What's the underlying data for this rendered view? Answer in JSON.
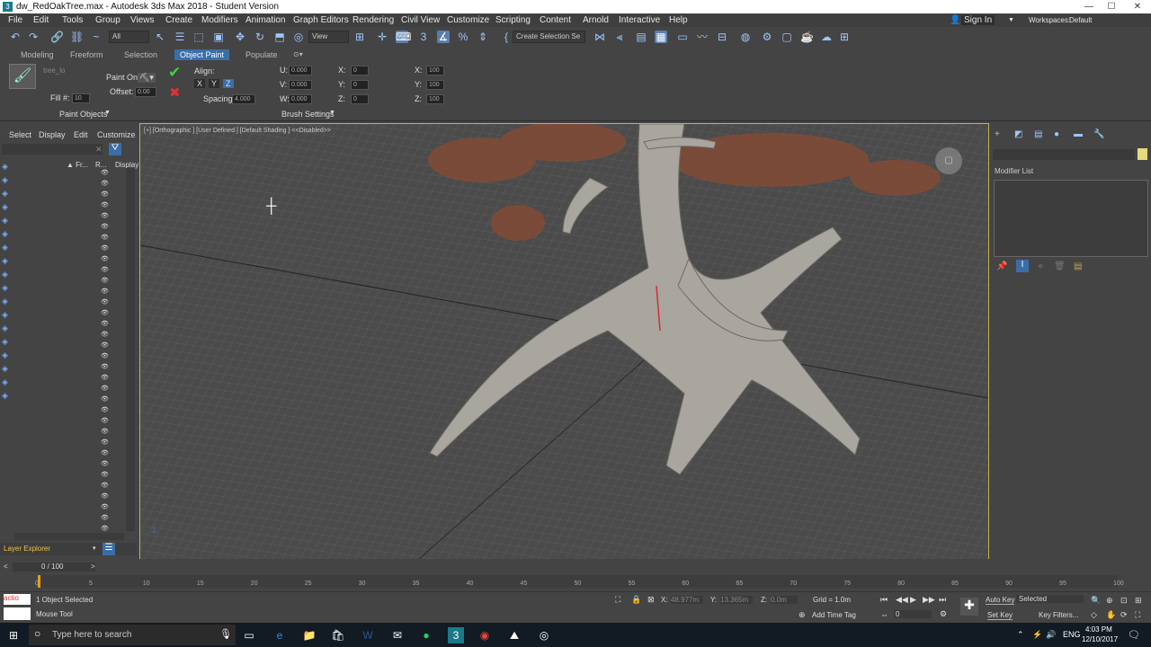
{
  "window": {
    "title": "dw_RedOakTree.max - Autodesk 3ds Max 2018 - Student Version",
    "controls": [
      "—",
      "☐",
      "✕"
    ]
  },
  "menu": {
    "items": [
      "File",
      "Edit",
      "Tools",
      "Group",
      "Views",
      "Create",
      "Modifiers",
      "Animation",
      "Graph Editors",
      "Rendering",
      "Civil View",
      "Customize",
      "Scripting",
      "Content",
      "Arnold",
      "Interactive",
      "Help"
    ],
    "sign_in": "Sign In",
    "workspaces_label": "Workspaces:",
    "workspace_value": "Default"
  },
  "toolbar": {
    "filter_value": "All",
    "view_value": "View",
    "selection_set": "Create Selection Se"
  },
  "ribbon": {
    "tabs": [
      "Modeling",
      "Freeform",
      "Selection",
      "Object Paint",
      "Populate"
    ],
    "active_tab": "Object Paint",
    "tree_name": "tree_lo",
    "paint_on_label": "Paint On:",
    "offset_label": "Offset:",
    "offset_value": "0.00",
    "fill_label": "Fill #:",
    "fill_value": "10",
    "align_label": "Align:",
    "axes": [
      "X",
      "Y",
      "Z"
    ],
    "spacing_label": "Spacing:",
    "spacing_value": "4.000",
    "u_label": "U:",
    "u_value": "0.000",
    "v_label": "V:",
    "v_value": "0.000",
    "w_label": "W:",
    "w_value": "0.000",
    "rx_label": "X:",
    "rx_value": "0",
    "ry_label": "Y:",
    "ry_value": "0",
    "rz_label": "Z:",
    "rz_value": "0",
    "sx_label": "X:",
    "sx_value": "100",
    "sy_label": "Y:",
    "sy_value": "100",
    "sz_label": "Z:",
    "sz_value": "100",
    "paint_objects_label": "Paint Objects",
    "brush_settings_label": "Brush Settings"
  },
  "scene_explorer": {
    "menu": [
      "Select",
      "Display",
      "Edit",
      "Customize"
    ],
    "col_frozen": "▲ Fr...",
    "col_render": "R...",
    "col_display": "Display",
    "layer_explorer_label": "Layer Explorer"
  },
  "viewport": {
    "label": "[+] [Orthographic ] [User Defined ] [Default Shading ]  <<Disabled>>"
  },
  "command_panel": {
    "modifier_list_label": "Modifier List"
  },
  "timeline": {
    "frame_counter": "0 / 100",
    "ticks": [
      "0",
      "5",
      "10",
      "15",
      "20",
      "25",
      "30",
      "35",
      "40",
      "45",
      "50",
      "55",
      "60",
      "65",
      "70",
      "75",
      "80",
      "85",
      "90",
      "95",
      "100"
    ]
  },
  "status": {
    "maxscript_label": "actio",
    "selected_text": "1 Object Selected",
    "prompt_text": "Mouse Tool",
    "x_label": "X:",
    "x_value": "48.977m",
    "y_label": "Y:",
    "y_value": "13.365m",
    "z_label": "Z:",
    "z_value": "0.0m",
    "grid_text": "Grid = 1.0m",
    "add_time_tag": "Add Time Tag",
    "frame_value": "0",
    "auto_key": "Auto Key",
    "set_key": "Set Key",
    "selected_dropdown": "Selected",
    "key_filters": "Key Filters..."
  },
  "taskbar": {
    "search_placeholder": "Type here to search",
    "lang": "ENG",
    "time": "4:03 PM",
    "date": "12/10/2017"
  },
  "colors": {
    "accent": "#3a6ea8",
    "viewport_border": "#c6b14a",
    "tree_bark": "#a8a69e",
    "foliage": "#8a4a32"
  }
}
